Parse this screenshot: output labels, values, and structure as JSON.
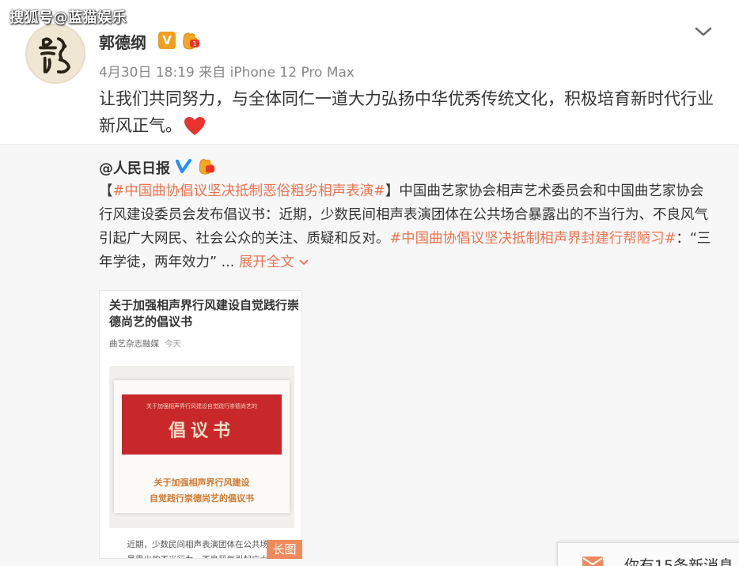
{
  "watermark": "搜狐号@蓝猫娱乐",
  "post": {
    "author": "郭德纲",
    "verified_badge": "V",
    "meta": "4月30日 18:19 来自 iPhone 12 Pro Max",
    "text": "让我们共同努力，与全体同仁一道大力弘扬中华优秀传统文化，积极培育新时代行业新风正气。",
    "avatar_calligraphy": "郭"
  },
  "repost": {
    "author": "@人民日报",
    "bracket_open": "【",
    "tag1": "#中国曲协倡议坚决抵制恶俗粗劣相声表演#",
    "bracket_close": "】",
    "body": "中国曲艺家协会相声艺术委员会和中国曲艺家协会行风建设委员会发布倡议书：近期，少数民间相声表演团体在公共场合暴露出的不当行为、不良风气引起广大网民、社会公众的关注、质疑和反对。",
    "tag2": "#中国曲协倡议坚决抵制相声界封建行帮陋习#",
    "quote": "：“三年学徒，两年效力” ...",
    "expand": "展开全文",
    "card": {
      "title": "关于加强相声界行风建设自觉践行崇德尚艺的倡议书",
      "source": "曲艺杂志融媒",
      "date": "今天",
      "doc_small": "关于加强相声界行风建设自觉践行崇德尚艺的",
      "doc_big": "倡议书",
      "doc_sub_1": "关于加强相声界行风建设",
      "doc_sub_2": "自觉践行崇德尚艺的倡议书",
      "body_1": "近期，少数民间相声表演团体在公共场合",
      "body_2": "暴露出的不当行为、不良风气引起广大网",
      "long_badge": "长图"
    }
  },
  "notice": {
    "text": "你有15条新消息"
  },
  "colors": {
    "accent": "#eb7350",
    "verified_gold": "#f0a020",
    "verified_blue": "#1e90ff",
    "heart": "#e8342c"
  }
}
